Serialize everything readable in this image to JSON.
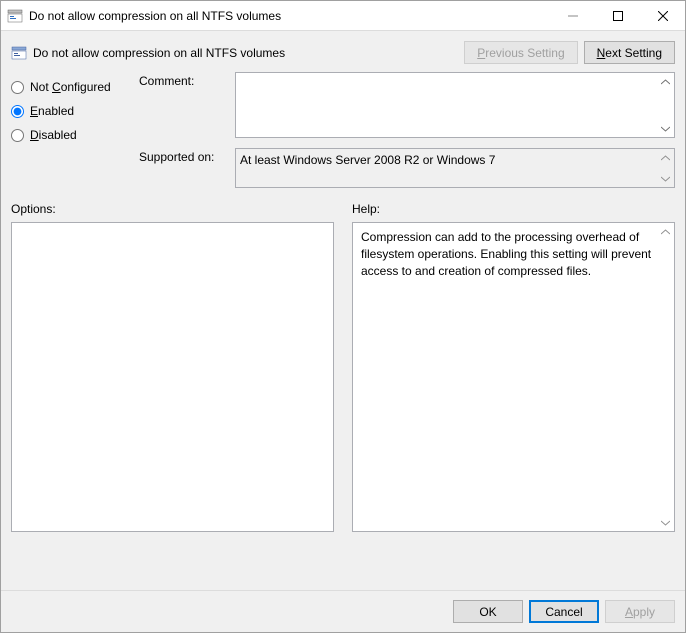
{
  "window": {
    "title": "Do not allow compression on all NTFS volumes"
  },
  "header": {
    "policy_title": "Do not allow compression on all NTFS volumes",
    "prev_setting": "Previous Setting",
    "next_setting": "Next Setting"
  },
  "radios": {
    "not_configured": "Not Configured",
    "enabled": "Enabled",
    "disabled": "Disabled",
    "selected": "enabled"
  },
  "labels": {
    "comment": "Comment:",
    "supported_on": "Supported on:",
    "options": "Options:",
    "help": "Help:"
  },
  "comment_value": "",
  "supported_on_value": "At least Windows Server 2008 R2 or Windows 7",
  "options_content": "",
  "help_content": "Compression can add to the processing overhead of filesystem operations.  Enabling this setting will prevent access to and creation of compressed files.",
  "footer": {
    "ok": "OK",
    "cancel": "Cancel",
    "apply": "Apply"
  }
}
